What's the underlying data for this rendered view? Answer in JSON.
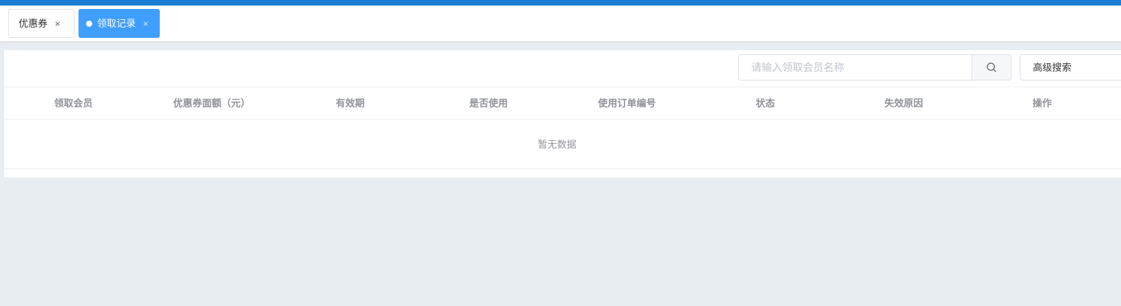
{
  "colors": {
    "top_bar": "#1a7fd4",
    "active_tab": "#409eff",
    "background": "#e8edf1"
  },
  "tabs": [
    {
      "label": "优惠券",
      "close": "×",
      "active": false
    },
    {
      "label": "领取记录",
      "close": "×",
      "active": true
    }
  ],
  "toolbar": {
    "search_placeholder": "请输入领取会员名称",
    "search_icon": "search-icon",
    "advanced_search_label": "高级搜索"
  },
  "table": {
    "columns": [
      "领取会员",
      "优惠券面额（元）",
      "有效期",
      "是否使用",
      "使用订单编号",
      "状态",
      "失效原因",
      "操作"
    ],
    "empty_text": "暂无数据"
  }
}
